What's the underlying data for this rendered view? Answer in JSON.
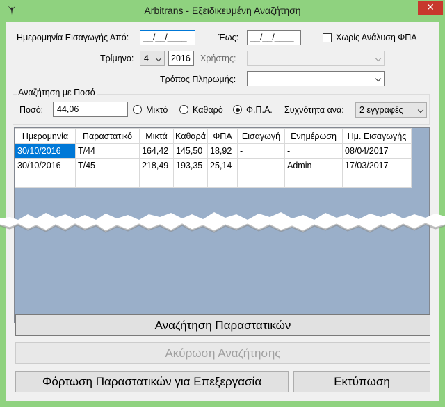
{
  "window": {
    "title": "Arbitrans - Εξειδικευμένη Αναζήτηση",
    "close_symbol": "✕"
  },
  "filters": {
    "date_from_label": "Ημερομηνία Εισαγωγής Από:",
    "date_from_value": "__/__/____",
    "date_to_label": "Έως:",
    "date_to_value": "__/__/____",
    "no_vat_label": "Χωρίς Ανάλυση ΦΠΑ",
    "quarter_label": "Τρίμηνο:",
    "quarter_value": "4",
    "year_value": "2016",
    "user_label": "Χρήστης:",
    "user_value": "",
    "payment_label": "Τρόπος Πληρωμής:",
    "payment_value": ""
  },
  "amount_search": {
    "title": "Αναζήτηση με Ποσό",
    "amount_label": "Ποσό:",
    "amount_value": "44,06",
    "options": [
      "Μικτό",
      "Καθαρό",
      "Φ.Π.Α."
    ],
    "selected": "Φ.Π.Α.",
    "frequency_label": "Συχνότητα ανά:",
    "frequency_value": "2 εγγραφές"
  },
  "results": {
    "columns": [
      "Ημερομηνία",
      "Παραστατικό",
      "Μικτά",
      "Καθαρά",
      "ΦΠΑ",
      "Εισαγωγή",
      "Ενημέρωση",
      "Ημ. Εισαγωγής"
    ],
    "rows": [
      [
        "30/10/2016",
        "Τ/44",
        "164,42",
        "145,50",
        "18,92",
        "-",
        "-",
        "08/04/2017"
      ],
      [
        "30/10/2016",
        "Τ/45",
        "218,49",
        "193,35",
        "25,14",
        "-",
        "Admin",
        "17/03/2017"
      ],
      [
        "",
        "",
        "",
        "",
        "",
        "",
        "",
        ""
      ]
    ]
  },
  "buttons": {
    "search": "Αναζήτηση Παραστατικών",
    "cancel": "Ακύρωση Αναζήτησης",
    "load": "Φόρτωση Παραστατικών για Επεξεργασία",
    "print": "Εκτύπωση"
  },
  "colors": {
    "window_frame": "#8fd27f",
    "selection": "#0078d7",
    "close_button": "#c7392d",
    "grid_background": "#9aafc9"
  }
}
